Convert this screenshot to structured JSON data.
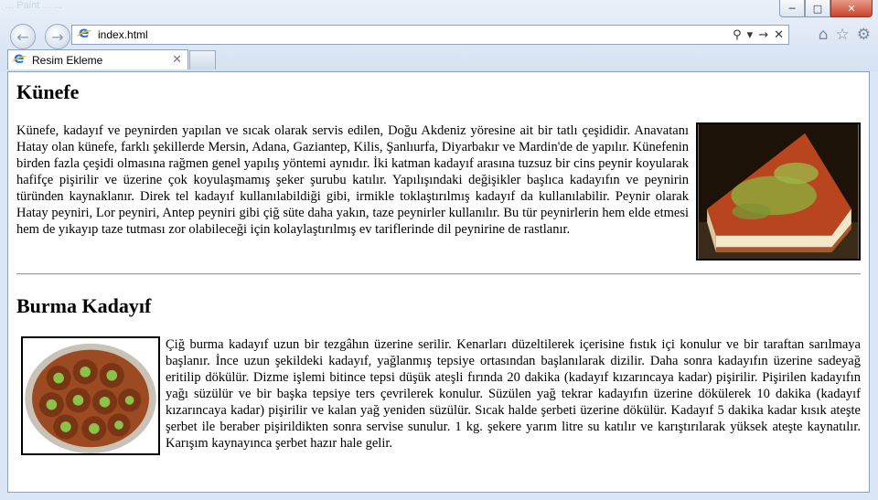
{
  "window": {
    "faded_title": "... Paint ... ...",
    "buttons": [
      "─",
      "□",
      "✕"
    ]
  },
  "nav": {
    "back": "←",
    "forward": "→"
  },
  "address": {
    "url": "index.html",
    "tools": [
      "⚲",
      "▾",
      "→",
      "✕"
    ]
  },
  "toolbar_icons": [
    "⌂",
    "☆",
    "⚙"
  ],
  "tab": {
    "title": "Resim Ekleme",
    "close": "✕"
  },
  "sections": [
    {
      "heading": "Künefe",
      "text": "Künefe, kadayıf ve peynirden yapılan ve sıcak olarak servis edilen, Doğu Akdeniz yöresine ait bir tatlı çeşididir. Anavatanı Hatay olan künefe, farklı şekillerde Mersin, Adana, Gaziantep, Kilis, Şanlıurfa, Diyarbakır ve Mardin'de de yapılır. Künefenin birden fazla çeşidi olmasına rağmen genel yapılış yöntemi aynıdır. İki katman kadayıf arasına tuzsuz bir cins peynir koyularak hafifçe pişirilir ve üzerine çok koyulaşmamış şeker şurubu katılır. Yapılışındaki değişikler başlıca kadayıfın ve peynirin türünden kaynaklanır. Direk tel kadayıf kullanılabildiği gibi, irmikle toklaştırılmış kadayıf da kullanılabilir. Peynir olarak Hatay peyniri, Lor peyniri, Antep peyniri gibi çiğ süte daha yakın, taze peynirler kullanılır. Bu tür peynirlerin hem elde etmesi hem de yıkayıp taze tutması zor olabileceği için kolaylaştırılmış ev tariflerinde dil peynirine de rastlanır."
    },
    {
      "heading": "Burma Kadayıf",
      "text": "Çiğ burma kadayıf uzun bir tezgâhın üzerine serilir. Kenarları düzeltilerek içerisine fıstık içi konulur ve bir taraftan sarılmaya başlanır. İnce uzun şekildeki kadayıf, yağlanmış tepsiye ortasından başlanılarak dizilir. Daha sonra kadayıfın üzerine sadeyağ eritilip dökülür. Dizme işlemi bitince tepsi düşük ateşli fırında 20 dakika (kadayıf kızarıncaya kadar) pişirilir. Pişirilen kadayıfın yağı süzülür ve bir başka tepsiye ters çevrilerek konulur. Süzülen yağ tekrar kadayıfın üzerine dökülerek 10 dakika (kadayıf kızarıncaya kadar) pişirilir ve kalan yağ yeniden süzülür. Sıcak halde şerbeti üzerine dökülür. Kadayıf 5 dakika kadar kısık ateşte şerbet ile beraber pişirildikten sonra servise sunulur. 1 kg. şekere yarım litre su katılır ve karıştırılarak yüksek ateşte kaynatılır. Karışım kaynayınca şerbet hazır hale gelir."
    }
  ]
}
